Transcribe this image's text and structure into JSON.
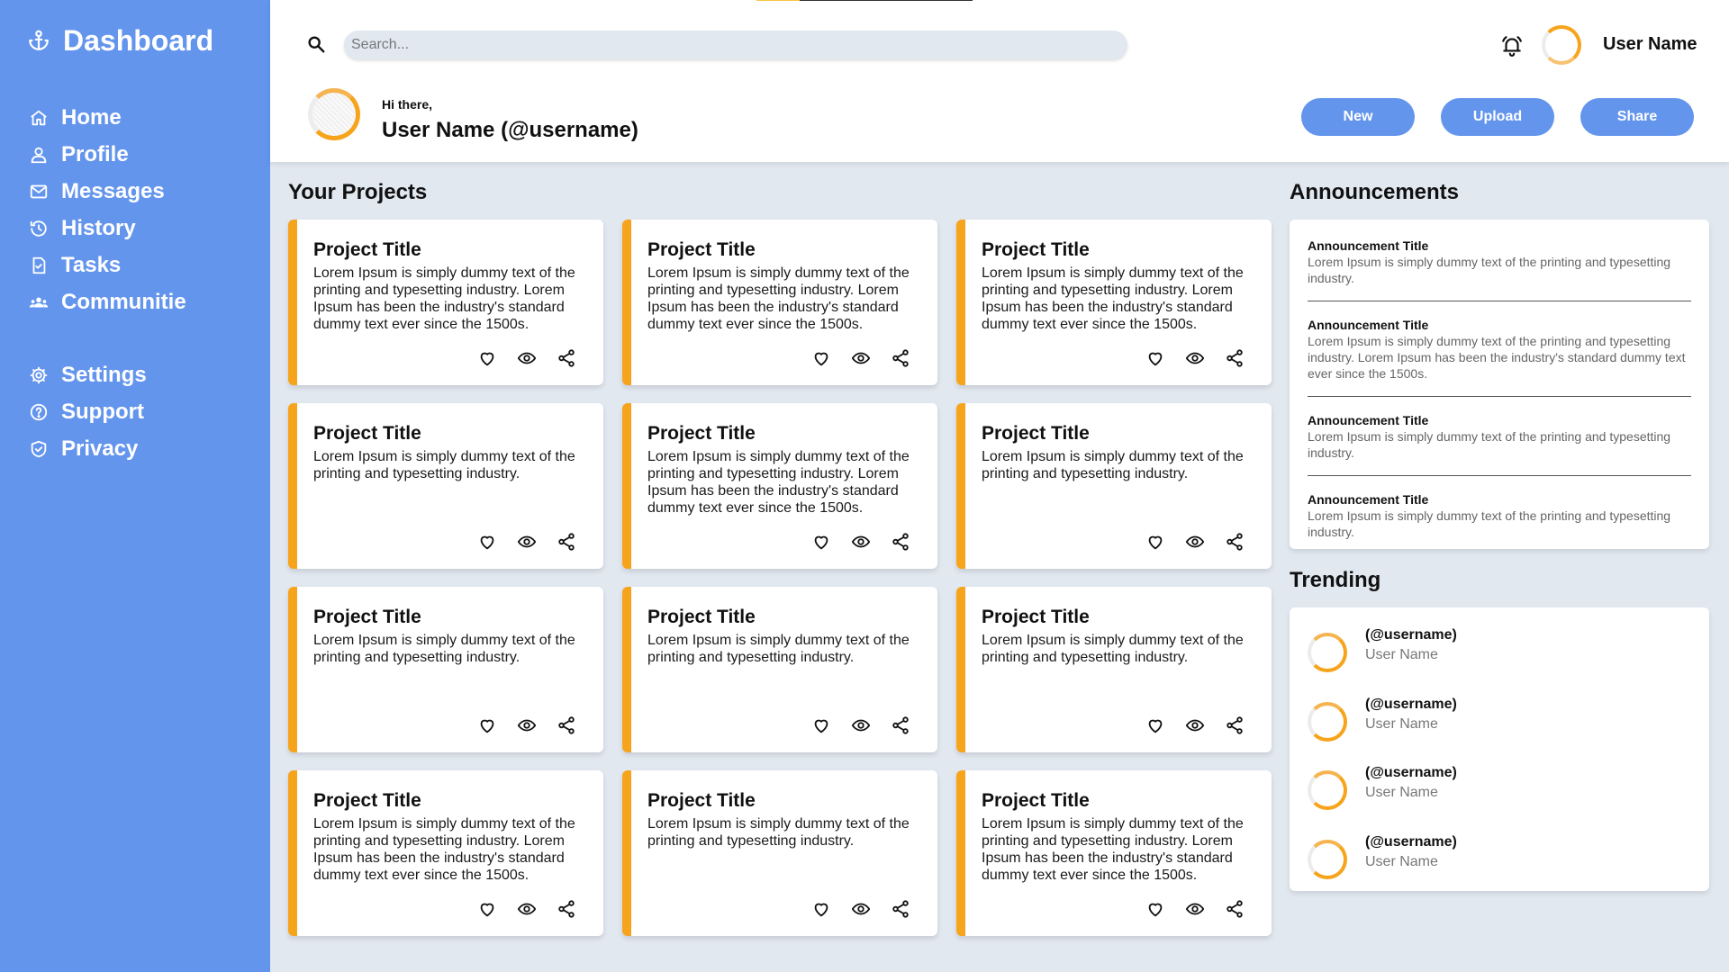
{
  "sidebar": {
    "brand": "Dashboard",
    "main_items": [
      {
        "label": "Home",
        "icon": "home-icon"
      },
      {
        "label": "Profile",
        "icon": "user-icon"
      },
      {
        "label": "Messages",
        "icon": "mail-icon"
      },
      {
        "label": "History",
        "icon": "history-icon"
      },
      {
        "label": "Tasks",
        "icon": "tasks-icon"
      },
      {
        "label": "Communitie",
        "icon": "community-icon"
      }
    ],
    "secondary_items": [
      {
        "label": "Settings",
        "icon": "gear-icon"
      },
      {
        "label": "Support",
        "icon": "help-icon"
      },
      {
        "label": "Privacy",
        "icon": "shield-icon"
      }
    ]
  },
  "header": {
    "search_placeholder": "Search...",
    "username": "User Name",
    "greeting": "Hi there,",
    "welcome_name": "User Name (@username)",
    "buttons": {
      "new": "New",
      "upload": "Upload",
      "share": "Share"
    }
  },
  "projects": {
    "title": "Your Projects",
    "items": [
      {
        "title": "Project Title",
        "desc": "Lorem Ipsum is simply dummy text of the printing and typesetting industry. Lorem Ipsum has been the industry's standard dummy text ever since the 1500s."
      },
      {
        "title": "Project Title",
        "desc": "Lorem Ipsum is simply dummy text of the printing and typesetting industry. Lorem Ipsum has been the industry's standard dummy text ever since the 1500s."
      },
      {
        "title": "Project Title",
        "desc": "Lorem Ipsum is simply dummy text of the printing and typesetting industry. Lorem Ipsum has been the industry's standard dummy text ever since the 1500s."
      },
      {
        "title": "Project Title",
        "desc": "Lorem Ipsum is simply dummy text of the printing and typesetting industry."
      },
      {
        "title": "Project Title",
        "desc": "Lorem Ipsum is simply dummy text of the printing and typesetting industry. Lorem Ipsum has been the industry's standard dummy text ever since the 1500s."
      },
      {
        "title": "Project Title",
        "desc": "Lorem Ipsum is simply dummy text of the printing and typesetting industry."
      },
      {
        "title": "Project Title",
        "desc": "Lorem Ipsum is simply dummy text of the printing and typesetting industry."
      },
      {
        "title": "Project Title",
        "desc": "Lorem Ipsum is simply dummy text of the printing and typesetting industry."
      },
      {
        "title": "Project Title",
        "desc": "Lorem Ipsum is simply dummy text of the printing and typesetting industry."
      },
      {
        "title": "Project Title",
        "desc": "Lorem Ipsum is simply dummy text of the printing and typesetting industry. Lorem Ipsum has been the industry's standard dummy text ever since the 1500s."
      },
      {
        "title": "Project Title",
        "desc": "Lorem Ipsum is simply dummy text of the printing and typesetting industry."
      },
      {
        "title": "Project Title",
        "desc": "Lorem Ipsum is simply dummy text of the printing and typesetting industry. Lorem Ipsum has been the industry's standard dummy text ever since the 1500s."
      }
    ],
    "action_icons": [
      "heart-icon",
      "eye-icon",
      "share-icon"
    ]
  },
  "announcements": {
    "title": "Announcements",
    "items": [
      {
        "title": "Announcement Title",
        "text": "Lorem Ipsum is simply dummy text of the printing and typesetting industry."
      },
      {
        "title": "Announcement Title",
        "text": "Lorem Ipsum is simply dummy text of the printing and typesetting industry. Lorem Ipsum has been the industry's standard dummy text ever since the 1500s."
      },
      {
        "title": "Announcement Title",
        "text": "Lorem Ipsum is simply dummy text of the printing and typesetting industry."
      },
      {
        "title": "Announcement Title",
        "text": "Lorem Ipsum is simply dummy text of the printing and typesetting industry."
      }
    ]
  },
  "trending": {
    "title": "Trending",
    "items": [
      {
        "handle": "(@username)",
        "name": "User Name"
      },
      {
        "handle": "(@username)",
        "name": "User Name"
      },
      {
        "handle": "(@username)",
        "name": "User Name"
      },
      {
        "handle": "(@username)",
        "name": "User Name"
      }
    ]
  },
  "colors": {
    "sidebar": "#6495ed",
    "accent": "#f7a41d",
    "background": "#e2e8f0",
    "button": "#6495ed"
  }
}
